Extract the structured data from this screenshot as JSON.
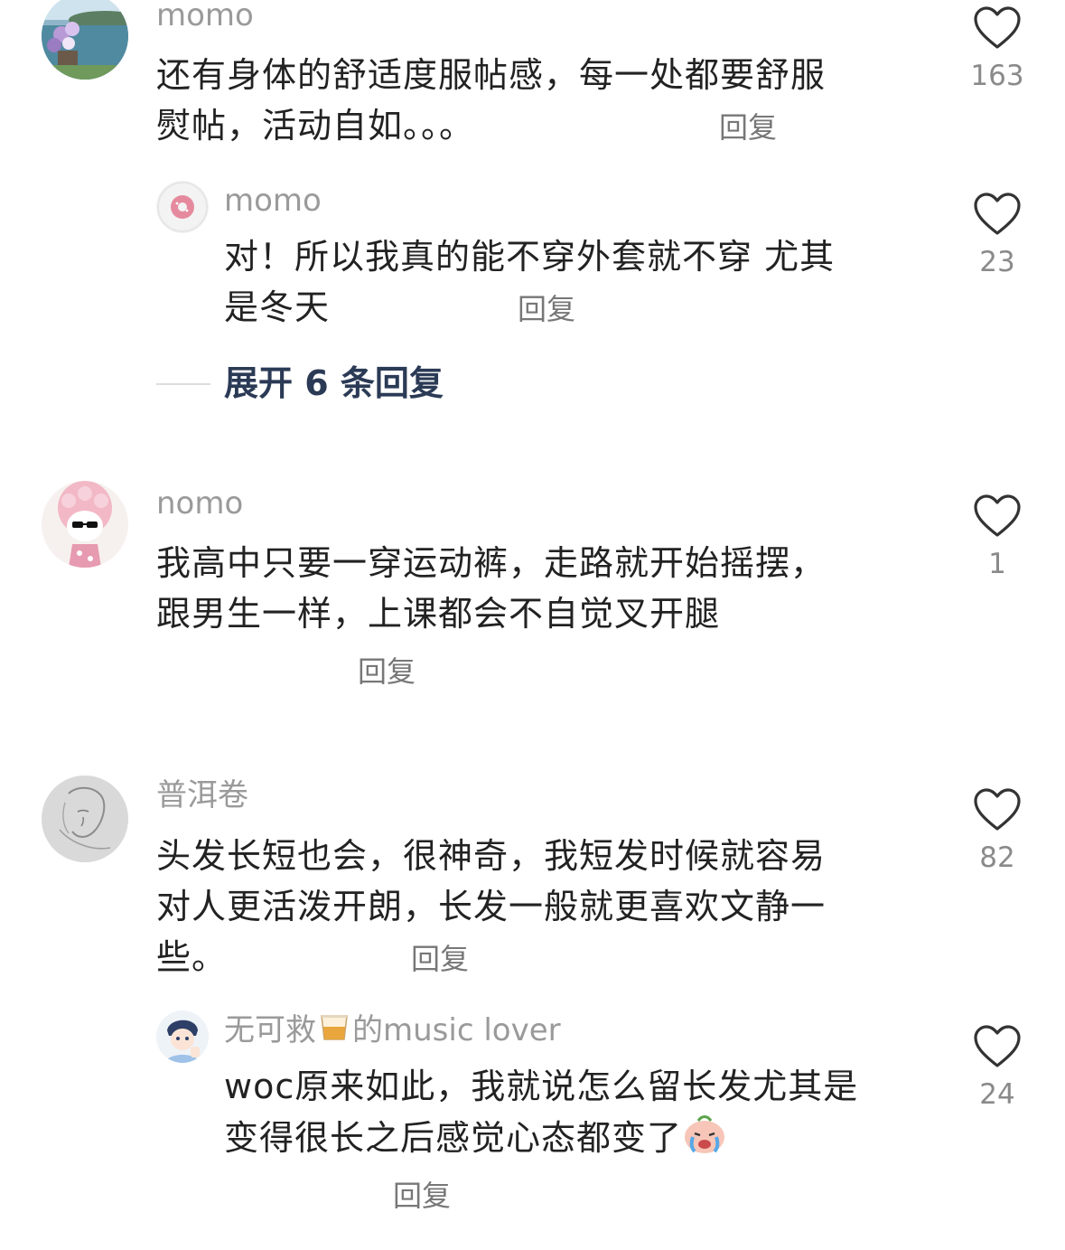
{
  "comments": [
    {
      "username": "momo",
      "line1": "还有身体的舒适度服帖感，每一处都要舒服",
      "line2": "熨帖，活动自如。。。",
      "reply_label": "回复",
      "likes": "163"
    },
    {
      "username": "momo",
      "line1": "对！所以我真的能不穿外套就不穿 尤其",
      "line2": "是冬天",
      "reply_label": "回复",
      "likes": "23"
    },
    {
      "username": "nomo",
      "line1": "我高中只要一穿运动裤，走路就开始摇摆，",
      "line2": "跟男生一样，上课都会不自觉叉开腿",
      "reply_label": "回复",
      "likes": "1"
    },
    {
      "username": "普洱卷",
      "line1": "头发长短也会，很神奇，我短发时候就容易",
      "line2": "对人更活泼开朗，长发一般就更喜欢文静一",
      "line3": "些。",
      "reply_label": "回复",
      "likes": "82"
    },
    {
      "username_a": "无可救",
      "username_b": "的music lover",
      "line1": "woc原来如此，我就说怎么留长发尤其是",
      "line2": "变得很长之后感觉心态都变了",
      "reply_label": "回复",
      "likes": "24"
    }
  ],
  "expand_label": "展开 6 条回复",
  "icons": {
    "like": "heart-outline-icon",
    "username_emoji": "glass-cup-icon",
    "text_emoji": "crying-face-icon"
  },
  "colors": {
    "username": "#9a9a9a",
    "text": "#222222",
    "expand": "#2b3a55",
    "reply": "#777777"
  }
}
